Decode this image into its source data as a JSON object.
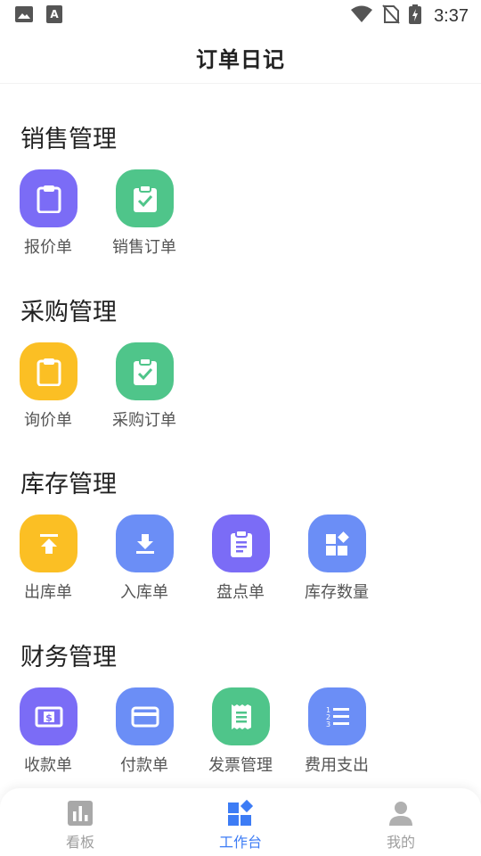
{
  "status_bar": {
    "time": "3:37",
    "icons": [
      "image-icon",
      "text-a-icon",
      "wifi-icon",
      "no-sim-icon",
      "battery-charging-icon"
    ]
  },
  "app_bar": {
    "title": "订单日记"
  },
  "sections": [
    {
      "title": "销售管理",
      "items": [
        {
          "label": "报价单",
          "icon": "clipboard-icon",
          "color": "#7b6cf6"
        },
        {
          "label": "销售订单",
          "icon": "clipboard-check-icon",
          "color": "#4fc58a"
        }
      ]
    },
    {
      "title": "采购管理",
      "items": [
        {
          "label": "询价单",
          "icon": "clipboard-icon",
          "color": "#fbbf24"
        },
        {
          "label": "采购订单",
          "icon": "clipboard-check-icon",
          "color": "#4fc58a"
        }
      ]
    },
    {
      "title": "库存管理",
      "items": [
        {
          "label": "出库单",
          "icon": "upload-icon",
          "color": "#fbbf24"
        },
        {
          "label": "入库单",
          "icon": "download-icon",
          "color": "#6b8ef6"
        },
        {
          "label": "盘点单",
          "icon": "clipboard-list-icon",
          "color": "#7b6cf6"
        },
        {
          "label": "库存数量",
          "icon": "widgets-icon",
          "color": "#6b8ef6"
        }
      ]
    },
    {
      "title": "财务管理",
      "items": [
        {
          "label": "收款单",
          "icon": "money-icon",
          "color": "#7b6cf6"
        },
        {
          "label": "付款单",
          "icon": "credit-card-icon",
          "color": "#6b8ef6"
        },
        {
          "label": "发票管理",
          "icon": "receipt-icon",
          "color": "#4fc58a"
        },
        {
          "label": "费用支出",
          "icon": "numbered-list-icon",
          "color": "#6b8ef6"
        }
      ]
    }
  ],
  "tab_bar": {
    "active_color": "#3d7cf5",
    "inactive_color": "#9e9e9e",
    "tabs": [
      {
        "label": "看板",
        "icon": "bar-chart-icon",
        "active": false
      },
      {
        "label": "工作台",
        "icon": "widgets-icon",
        "active": true
      },
      {
        "label": "我的",
        "icon": "person-icon",
        "active": false
      }
    ]
  }
}
